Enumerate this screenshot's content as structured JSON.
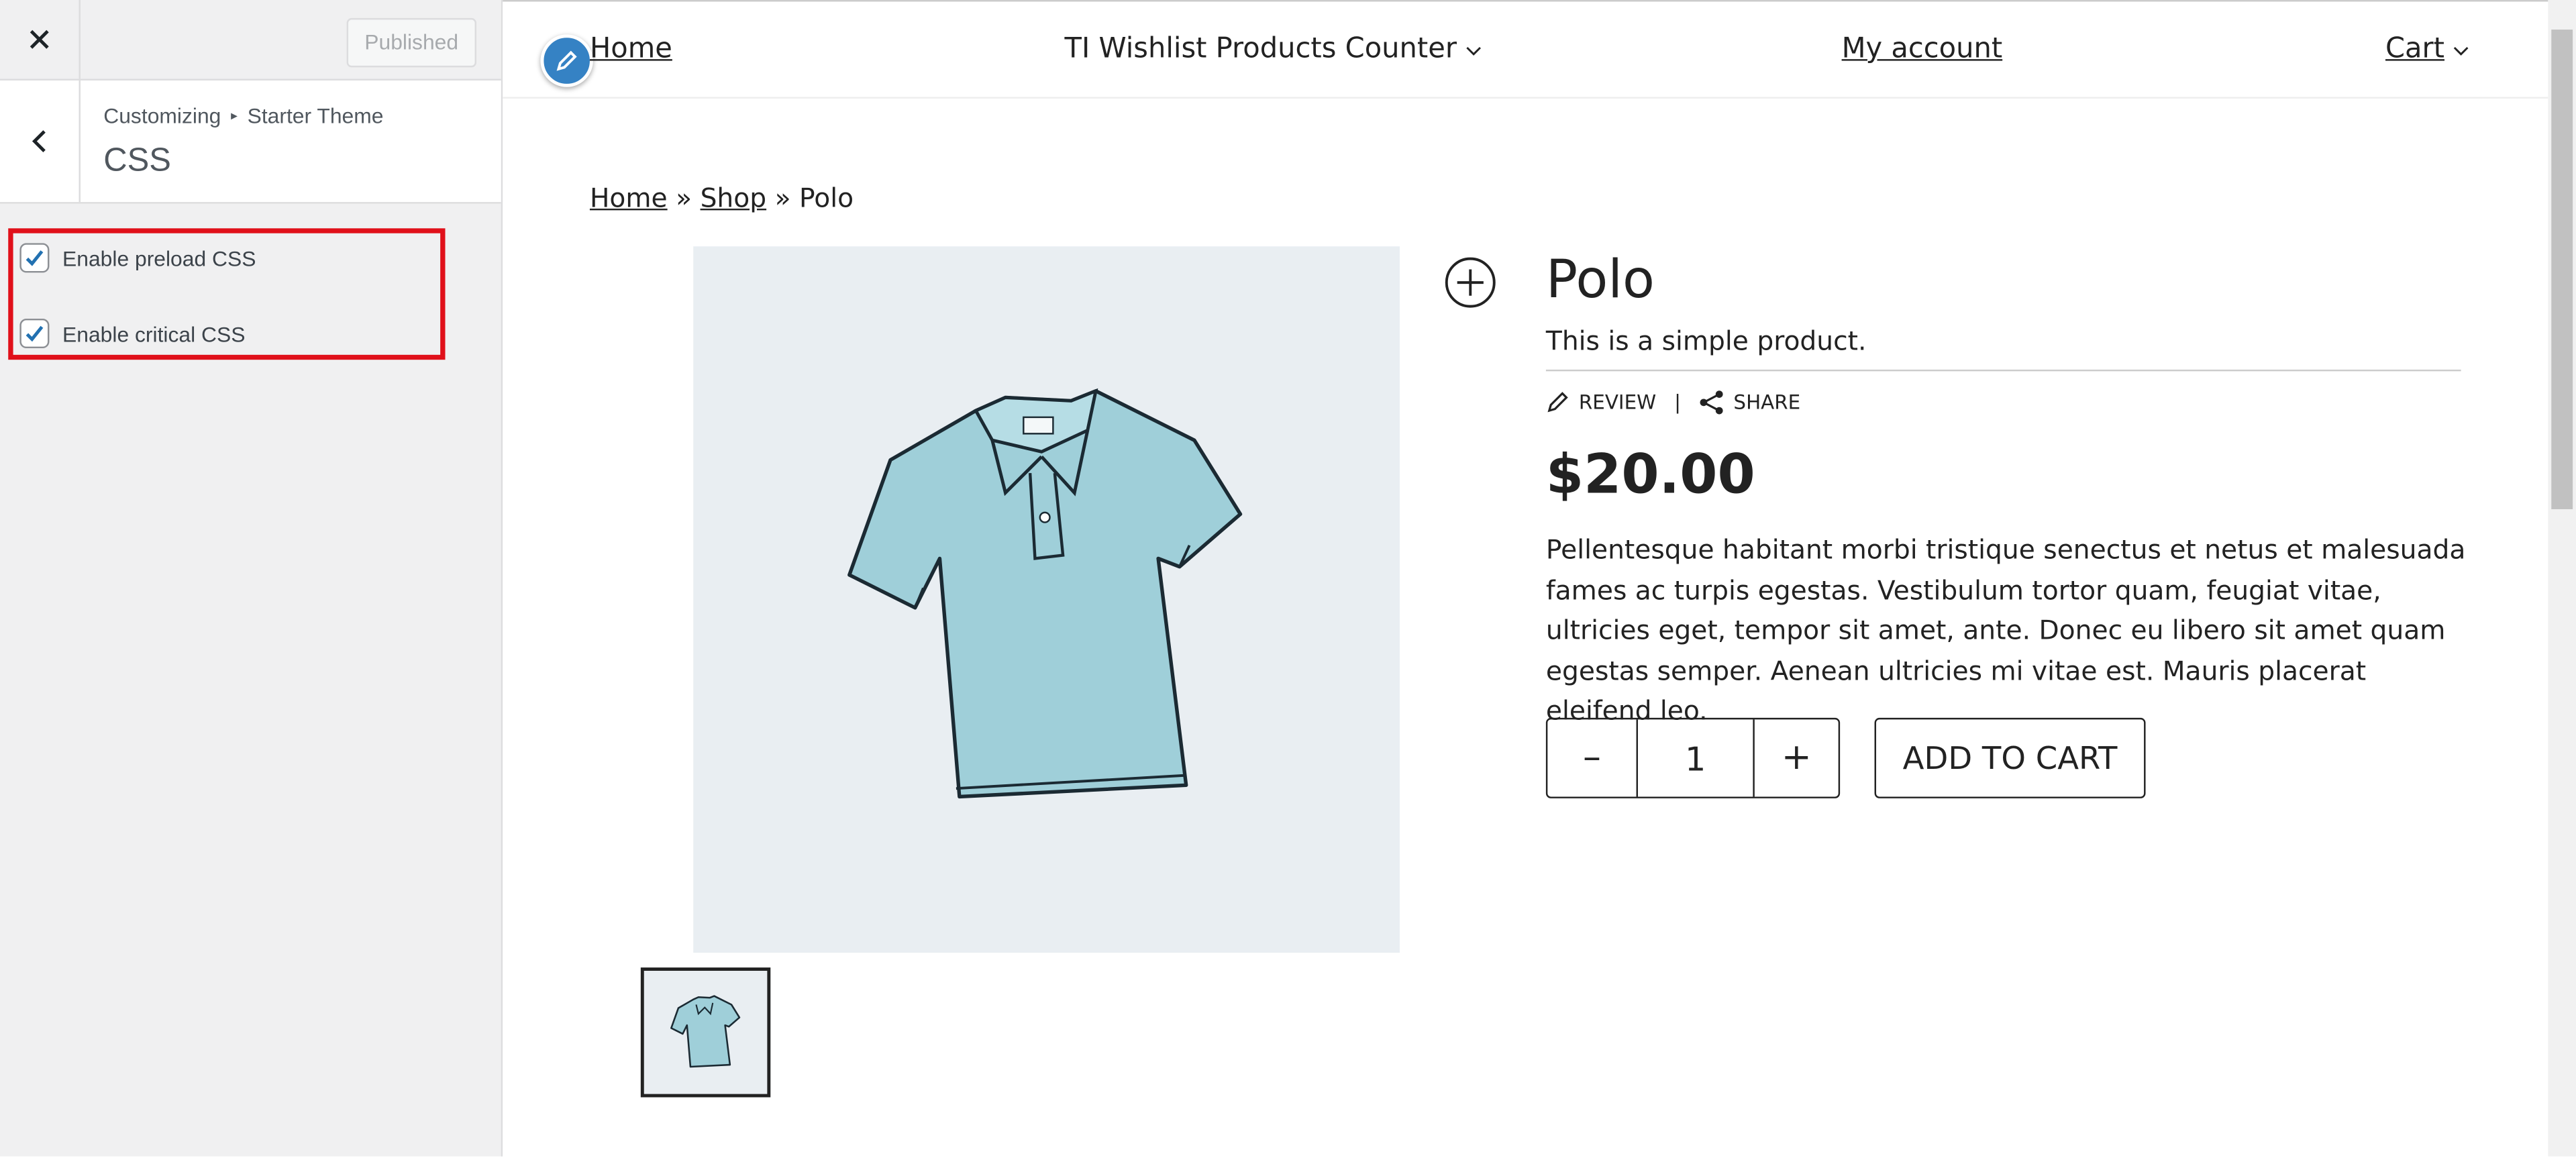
{
  "customizer": {
    "publish_label": "Published",
    "breadcrumb_root": "Customizing",
    "breadcrumb_theme": "Starter Theme",
    "section_title": "CSS",
    "options": [
      {
        "label": "Enable preload CSS",
        "checked": true
      },
      {
        "label": "Enable critical CSS",
        "checked": true
      }
    ],
    "highlight_color": "#e0101a"
  },
  "nav": {
    "home": "Home",
    "wishlist": "TI Wishlist Products Counter",
    "account": "My account",
    "cart": "Cart"
  },
  "breadcrumb": {
    "home": "Home",
    "sep": "»",
    "shop": "Shop",
    "current": "Polo"
  },
  "product": {
    "name": "Polo",
    "short_description": "This is a simple product.",
    "review_label": "REVIEW",
    "action_separator": "|",
    "share_label": "SHARE",
    "price": "$20.00",
    "description": "Pellentesque habitant morbi tristique senectus et netus et malesuada fames ac turpis egestas. Vestibulum tortor quam, feugiat vitae, ultricies eget, tempor sit amet, ante. Donec eu libero sit amet quam egestas semper. Aenean ultricies mi vitae est. Mauris placerat eleifend leo.",
    "quantity": "1",
    "qty_minus": "–",
    "qty_plus": "+",
    "add_to_cart": "ADD TO CART",
    "shirt_color": "#9fcfd9"
  },
  "icons": [
    "close-icon",
    "chevron-left-icon",
    "pencil-icon",
    "chevron-down-icon",
    "plus-circle-icon",
    "share-icon",
    "polo-shirt-image"
  ]
}
